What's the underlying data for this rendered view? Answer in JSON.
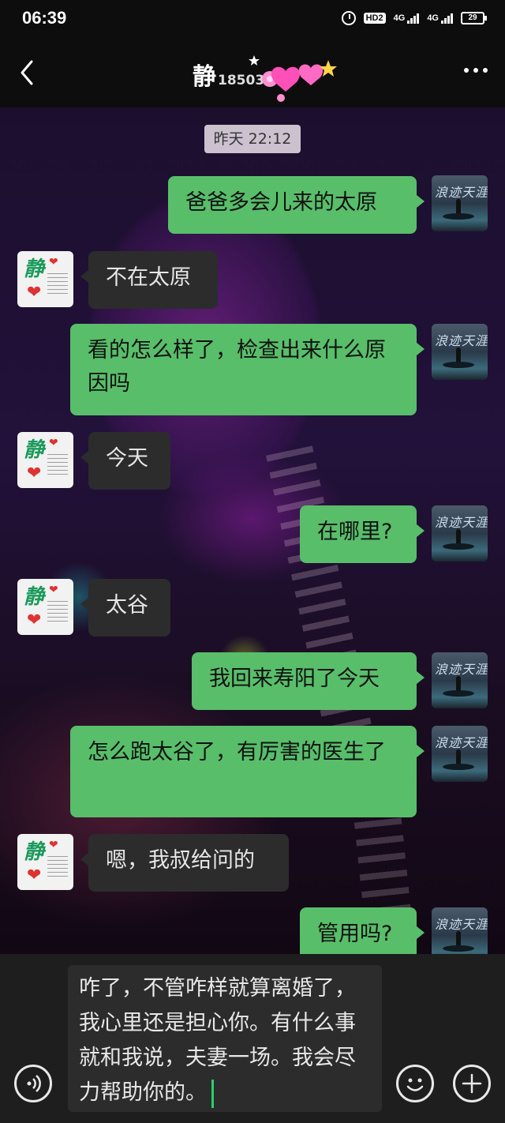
{
  "status_bar": {
    "time": "06:39",
    "hd_label": "HD2",
    "network_1": "4G",
    "network_2": "4G",
    "battery": "29"
  },
  "header": {
    "title": "静",
    "phone_number_partial": "18503",
    "back_icon": "chevron-left-icon",
    "more_icon": "more-dots-icon"
  },
  "chat": {
    "timestamp": "昨天 22:12",
    "messages": [
      {
        "side": "right",
        "text": "爸爸多会儿来的太原"
      },
      {
        "side": "left",
        "text": "不在太原"
      },
      {
        "side": "right",
        "text": "看的怎么样了，检查出来什么原因吗"
      },
      {
        "side": "left",
        "text": "今天"
      },
      {
        "side": "right",
        "text": "在哪里?"
      },
      {
        "side": "left",
        "text": "太谷"
      },
      {
        "side": "right",
        "text": "我回来寿阳了今天"
      },
      {
        "side": "right",
        "text": "怎么跑太谷了，有厉害的医生了"
      },
      {
        "side": "left",
        "text": "嗯，我叔给问的"
      },
      {
        "side": "right",
        "text": "管用吗?"
      }
    ],
    "left_avatar_text": "静",
    "right_avatar_text": "浪迹天涯"
  },
  "input_bar": {
    "draft_text": "咋了，不管咋样就算离婚了，我心里还是担心你。有什么事就和我说，夫妻一场。我会尽力帮助你的。",
    "voice_icon": "voice-icon",
    "emoji_icon": "emoji-icon",
    "plus_icon": "plus-icon"
  },
  "colors": {
    "bubble_sent": "#58be6a",
    "bubble_received": "#2c2c2c",
    "bar_background": "#0d0d0d"
  }
}
